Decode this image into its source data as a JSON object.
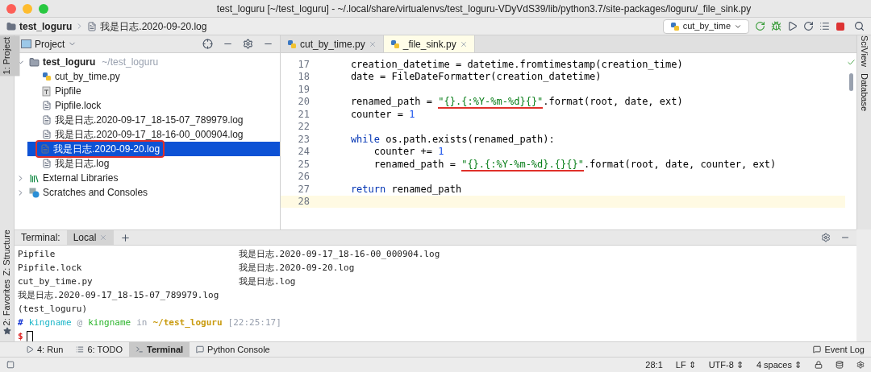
{
  "window": {
    "title": "test_loguru [~/test_loguru] - ~/.local/share/virtualenvs/test_loguru-VDyVdS39/lib/python3.7/site-packages/loguru/_file_sink.py"
  },
  "navbar": {
    "crumbs": [
      "test_loguru",
      "我是日志.2020-09-20.log"
    ],
    "run_config": "cut_by_time"
  },
  "left_stripe": [
    {
      "label": "1: Project",
      "selected": true
    },
    {
      "label": "Z: Structure",
      "selected": false
    },
    {
      "label": "2: Favorites",
      "selected": false
    }
  ],
  "right_stripe": [
    {
      "label": "SciView"
    },
    {
      "label": "Database"
    }
  ],
  "project": {
    "title": "Project",
    "tree": [
      {
        "label": "test_loguru",
        "hint": "~/test_loguru",
        "kind": "folder",
        "expanded": true,
        "selected": false,
        "circled": false,
        "children": [
          {
            "label": "cut_by_time.py",
            "kind": "python",
            "selected": false,
            "circled": false
          },
          {
            "label": "Pipfile",
            "kind": "pipfile",
            "selected": false,
            "circled": false
          },
          {
            "label": "Pipfile.lock",
            "kind": "text",
            "selected": false,
            "circled": false
          },
          {
            "label": "我是日志.2020-09-17_18-15-07_789979.log",
            "kind": "text",
            "selected": false,
            "circled": false
          },
          {
            "label": "我是日志.2020-09-17_18-16-00_000904.log",
            "kind": "text",
            "selected": false,
            "circled": false
          },
          {
            "label": "我是日志.2020-09-20.log",
            "kind": "text",
            "selected": true,
            "circled": true
          },
          {
            "label": "我是日志.log",
            "kind": "text",
            "selected": false,
            "circled": false
          }
        ]
      },
      {
        "label": "External Libraries",
        "kind": "library",
        "expanded": false,
        "selected": false,
        "circled": false
      },
      {
        "label": "Scratches and Consoles",
        "kind": "scratch",
        "expanded": false,
        "selected": false,
        "circled": false
      }
    ]
  },
  "editor": {
    "tabs": [
      {
        "label": "cut_by_time.py",
        "selected": false
      },
      {
        "label": "_file_sink.py",
        "selected": true
      }
    ],
    "lines": [
      {
        "number": "17",
        "current": false,
        "tokens": [
          {
            "kind": "plain",
            "text": "    creation_datetime = datetime.fromtimestamp(creation_time)"
          }
        ]
      },
      {
        "number": "18",
        "current": false,
        "tokens": [
          {
            "kind": "plain",
            "text": "    date = FileDateFormatter(creation_datetime)"
          }
        ]
      },
      {
        "number": "19",
        "current": false
      },
      {
        "number": "20",
        "current": false,
        "tokens": [
          {
            "kind": "plain",
            "text": "    renamed_path = "
          },
          {
            "kind": "string",
            "text": "\"{}.{:%Y-%m-%d}{}\"",
            "underlined": true
          },
          {
            "kind": "plain",
            "text": ".format(root, date, ext)"
          }
        ]
      },
      {
        "number": "21",
        "current": false,
        "tokens": [
          {
            "kind": "plain",
            "text": "    counter = "
          },
          {
            "kind": "number",
            "text": "1"
          }
        ]
      },
      {
        "number": "22",
        "current": false
      },
      {
        "number": "23",
        "current": false,
        "tokens": [
          {
            "kind": "keyword",
            "text": "    while"
          },
          {
            "kind": "plain",
            "text": " os.path.exists(renamed_path):"
          }
        ]
      },
      {
        "number": "24",
        "current": false,
        "tokens": [
          {
            "kind": "plain",
            "text": "        counter += "
          },
          {
            "kind": "number",
            "text": "1"
          }
        ]
      },
      {
        "number": "25",
        "current": false,
        "tokens": [
          {
            "kind": "plain",
            "text": "        renamed_path = "
          },
          {
            "kind": "string",
            "text": "\"{}.{:%Y-%m-%d}.{}{}\"",
            "underlined": true
          },
          {
            "kind": "plain",
            "text": ".format(root, date, counter, ext)"
          }
        ]
      },
      {
        "number": "26",
        "current": false
      },
      {
        "number": "27",
        "current": false,
        "tokens": [
          {
            "kind": "keyword",
            "text": "    return"
          },
          {
            "kind": "plain",
            "text": " renamed_path"
          }
        ]
      },
      {
        "number": "28",
        "current": true
      }
    ]
  },
  "terminal": {
    "label": "Terminal:",
    "tabs": [
      {
        "label": "Local",
        "selected": true
      }
    ],
    "listing": [
      [
        "Pipfile",
        "我是日志.2020-09-17_18-16-00_000904.log"
      ],
      [
        "Pipfile.lock",
        "我是日志.2020-09-20.log"
      ],
      [
        "cut_by_time.py",
        "我是日志.log"
      ],
      [
        "我是日志.2020-09-17_18-15-07_789979.log"
      ]
    ],
    "env": "(test_loguru)",
    "prompt": [
      {
        "kind": "hash",
        "text": "#"
      },
      {
        "kind": "user",
        "text": "kingname"
      },
      {
        "kind": "dim",
        "text": "@"
      },
      {
        "kind": "host",
        "text": "kingname"
      },
      {
        "kind": "dim",
        "text": "in"
      },
      {
        "kind": "path",
        "text": "~/test_loguru"
      },
      {
        "kind": "dim",
        "text": "[22:25:17]"
      }
    ],
    "input_prompt": "$"
  },
  "tool_tabs": [
    {
      "label": "4: Run",
      "kind": "run",
      "selected": false
    },
    {
      "label": "6: TODO",
      "kind": "todo",
      "selected": false
    },
    {
      "label": "Terminal",
      "kind": "terminal",
      "selected": true
    },
    {
      "label": "Python Console",
      "kind": "console",
      "selected": false
    }
  ],
  "event_log": "Event Log",
  "status_bar": [
    "28:1",
    "LF ⇕",
    "UTF-8 ⇕",
    "4 spaces ⇕"
  ]
}
